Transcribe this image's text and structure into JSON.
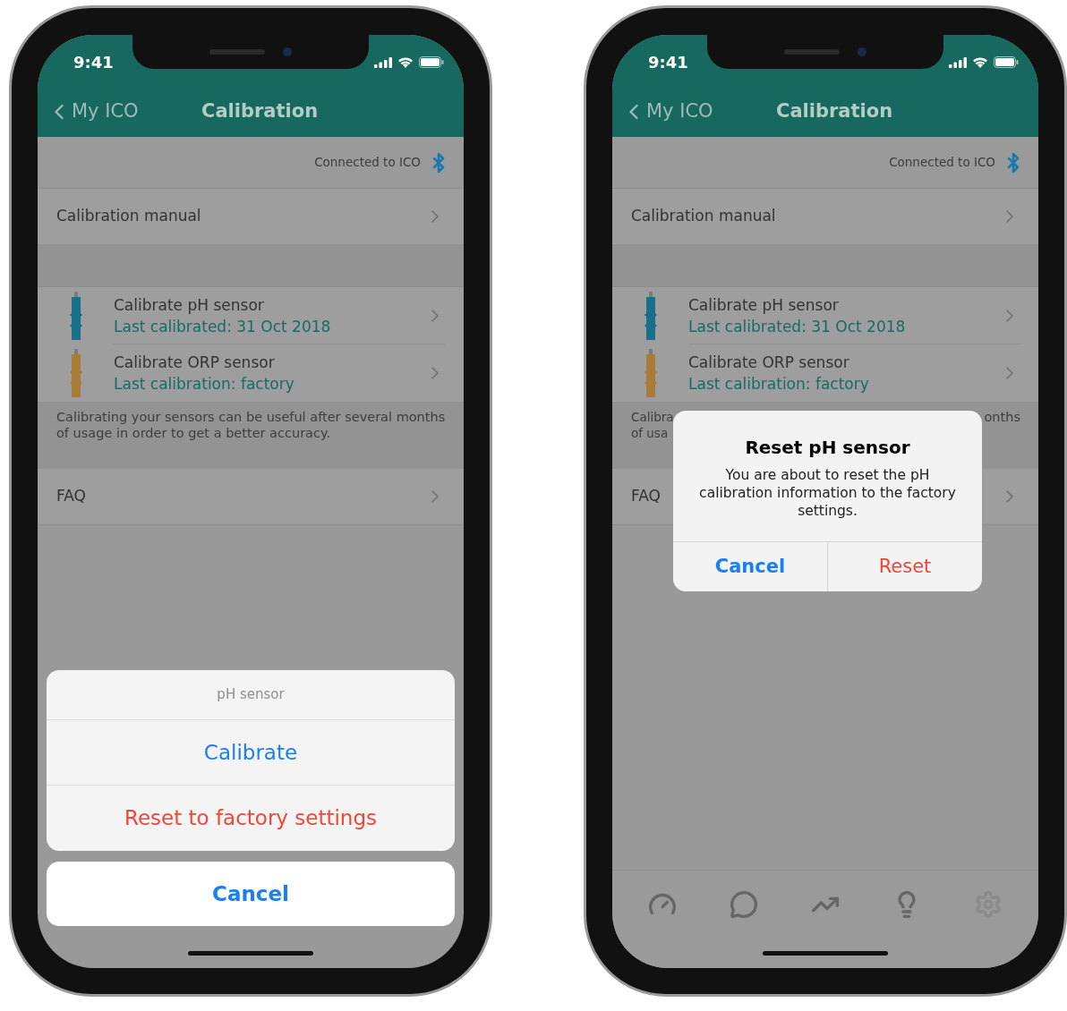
{
  "phones": [
    {
      "status_bar": {
        "time": "9:41"
      },
      "nav": {
        "back": "My ICO",
        "title": "Calibration"
      },
      "connection": "Connected to ICO",
      "manual": "Calibration manual",
      "sensors": [
        {
          "title": "Calibrate pH sensor",
          "subtitle": "Last calibrated: 31 Oct 2018",
          "color": "#19708a"
        },
        {
          "title": "Calibrate ORP sensor",
          "subtitle": "Last calibration: factory",
          "color": "#a67c36"
        }
      ],
      "note": {
        "text": "Calibrating your sensors can be useful after several months of usage in order to get a better accuracy."
      },
      "faq": "FAQ",
      "overlay": {
        "kind": "action_sheet",
        "title": "pH sensor",
        "actions": [
          {
            "label": "Calibrate",
            "kind": "default"
          },
          {
            "label": "Reset to factory settings",
            "kind": "destructive"
          }
        ],
        "cancel": "Cancel"
      }
    },
    {
      "status_bar": {
        "time": "9:41"
      },
      "nav": {
        "back": "My ICO",
        "title": "Calibration"
      },
      "connection": "Connected to ICO",
      "manual": "Calibration manual",
      "sensors": [
        {
          "title": "Calibrate pH sensor",
          "subtitle": "Last calibrated: 31 Oct 2018",
          "color": "#19708a"
        },
        {
          "title": "Calibrate ORP sensor",
          "subtitle": "Last calibration: factory",
          "color": "#a67c36"
        }
      ],
      "note": {
        "left_lines": [
          "Calibra",
          "of usa"
        ],
        "right_text": "onths"
      },
      "faq": "FAQ",
      "overlay": {
        "kind": "alert",
        "title": "Reset pH sensor",
        "message": "You are about to reset the pH calibration information to the factory settings.",
        "buttons": [
          {
            "label": "Cancel",
            "kind": "cancel"
          },
          {
            "label": "Reset",
            "kind": "destructive"
          }
        ]
      },
      "tab_bar": [
        {
          "selected": false
        },
        {
          "selected": false
        },
        {
          "selected": false
        },
        {
          "selected": false
        },
        {
          "selected": true
        }
      ]
    }
  ]
}
